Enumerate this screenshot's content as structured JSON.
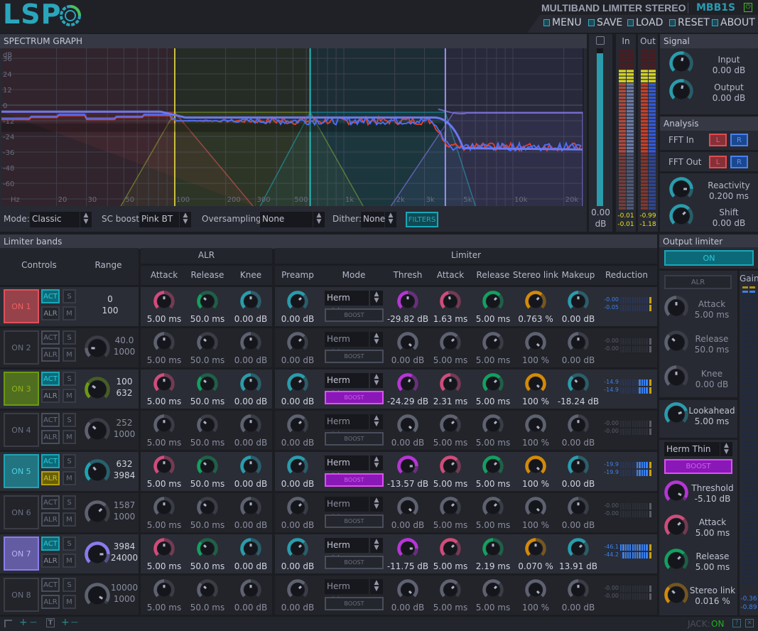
{
  "header": {
    "logo": "LSP",
    "plugin_title": "MULTIBAND LIMITER STEREO",
    "plugin_id": "MBB1S",
    "power_icon": "power-icon",
    "menu": [
      {
        "label": "MENU",
        "icon": "menu-icon"
      },
      {
        "label": "SAVE",
        "icon": "save-icon"
      },
      {
        "label": "LOAD",
        "icon": "load-icon"
      },
      {
        "label": "RESET",
        "icon": "reset-icon"
      },
      {
        "label": "ABOUT",
        "icon": "about-icon"
      }
    ]
  },
  "spectrum": {
    "title": "SPECTRUM GRAPH",
    "y_labels": [
      {
        "t": "dB",
        "db": 40
      },
      {
        "t": "36",
        "db": 36
      },
      {
        "t": "24",
        "db": 24
      },
      {
        "t": "12",
        "db": 12
      },
      {
        "t": "0",
        "db": 0
      },
      {
        "t": "-12",
        "db": -12
      },
      {
        "t": "-24",
        "db": -24
      },
      {
        "t": "-36",
        "db": -36
      },
      {
        "t": "-48",
        "db": -48
      },
      {
        "t": "-60",
        "db": -60
      }
    ],
    "x_labels": [
      {
        "t": "Hz",
        "f": 10.5
      },
      {
        "t": "20",
        "f": 20
      },
      {
        "t": "30",
        "f": 30
      },
      {
        "t": "50",
        "f": 50
      },
      {
        "t": "100",
        "f": 100
      },
      {
        "t": "200",
        "f": 200
      },
      {
        "t": "300",
        "f": 300
      },
      {
        "t": "500",
        "f": 500
      },
      {
        "t": "1k",
        "f": 1000
      },
      {
        "t": "2k",
        "f": 2000
      },
      {
        "t": "3k",
        "f": 3000
      },
      {
        "t": "5k",
        "f": 5000
      },
      {
        "t": "10k",
        "f": 10000
      },
      {
        "t": "20k",
        "f": 20000
      }
    ],
    "colors": {
      "input_left": "#e8402a",
      "input_right": "#4a70ff",
      "curve": "#6a78f0"
    },
    "controls": {
      "mode_label": "Mode:",
      "mode": "Classic",
      "sc_label": "SC boost:",
      "sc": "Pink BT",
      "os_label": "Oversampling:",
      "os": "None",
      "dither_label": "Dither:",
      "dither": "None",
      "filters": "FILTERS"
    }
  },
  "meters": {
    "zoom_value": "0.00",
    "zoom_unit": "dB",
    "zoom_level": 0.97,
    "in_label": "In",
    "out_label": "Out",
    "in_values": [
      "-0.01",
      "-0.01"
    ],
    "out_values": [
      "-0.99",
      "-1.18"
    ]
  },
  "signal": {
    "title": "Signal",
    "input_label": "Input",
    "input": "0.00 dB",
    "input_pos": 0.55,
    "output_label": "Output",
    "output": "0.00 dB",
    "output_pos": 0.55
  },
  "analysis": {
    "title": "Analysis",
    "fft_in": "FFT In",
    "fft_out": "FFT Out",
    "l": "L",
    "r": "R",
    "reactivity_label": "Reactivity",
    "reactivity": "0.200 ms",
    "reactivity_pos": 0.83,
    "shift_label": "Shift",
    "shift": "0.00 dB",
    "shift_pos": 0.67
  },
  "bands_panel": {
    "title": "Limiter bands",
    "controls": "Controls",
    "range": "Range",
    "alr": "ALR",
    "limiter": "Limiter",
    "alr_cols": [
      "Attack",
      "Release",
      "Knee"
    ],
    "lim_cols": [
      "Preamp",
      "Mode",
      "Thresh",
      "Attack",
      "Release",
      "Stereo link",
      "Makeup",
      "Reduction"
    ],
    "labels": {
      "act": "ACT",
      "alr": "ALR",
      "solo": "S",
      "mute": "M",
      "boost": "BOOST"
    },
    "knob_colors": {
      "attack": "#d04c7c",
      "release": "#12a060",
      "cyan": "#2a9cac",
      "thresh": "#b834d8",
      "link": "#d48a08",
      "inactive": "#565a66"
    }
  },
  "bands": [
    {
      "label": "ON 1",
      "color": "#e0505a",
      "active": true,
      "act": true,
      "alr": false,
      "range": [
        "0",
        "100"
      ],
      "range_pos": null,
      "alr_knobs": [
        {
          "v": "5.00 ms",
          "p": 0.5
        },
        {
          "v": "50.0 ms",
          "p": 0.33
        },
        {
          "v": "0.00 dB",
          "p": 0.5
        }
      ],
      "preamp": {
        "v": "0.00 dB",
        "p": 0.67
      },
      "mode": "Herm Thin",
      "boost": false,
      "lim": [
        {
          "v": "-29.82 dB",
          "p": 0.5
        },
        {
          "v": "1.63 ms",
          "p": 0.45
        },
        {
          "v": "5.00 ms",
          "p": 0.67
        },
        {
          "v": "0.763 %",
          "p": 0.65
        },
        {
          "v": "0.00 dB",
          "p": 0.5
        }
      ],
      "reduction": [
        "-0.00",
        "-0.05"
      ]
    },
    {
      "label": "ON 2",
      "color": "#4a4e5a",
      "active": false,
      "act": false,
      "alr": false,
      "range": [
        "40.0",
        "1000"
      ],
      "range_pos": 0.17,
      "alr_knobs": [
        {
          "v": "5.00 ms",
          "p": 0.5
        },
        {
          "v": "50.0 ms",
          "p": 0.33
        },
        {
          "v": "0.00 dB",
          "p": 0.5
        }
      ],
      "preamp": {
        "v": "0.00 dB",
        "p": 0.67
      },
      "mode": "Herm Thin",
      "boost": false,
      "lim": [
        {
          "v": "0.00 dB",
          "p": 1.0
        },
        {
          "v": "5.00 ms",
          "p": 0.67
        },
        {
          "v": "5.00 ms",
          "p": 0.67
        },
        {
          "v": "100 %",
          "p": 1.0
        },
        {
          "v": "0.00 dB",
          "p": 0.5
        }
      ],
      "reduction": [
        "-0.00",
        "-0.00"
      ]
    },
    {
      "label": "ON 3",
      "color": "#6a9a12",
      "active": true,
      "act": true,
      "alr": false,
      "range": [
        "100",
        "632"
      ],
      "range_pos": 0.3,
      "alr_knobs": [
        {
          "v": "5.00 ms",
          "p": 0.5
        },
        {
          "v": "50.0 ms",
          "p": 0.33
        },
        {
          "v": "0.00 dB",
          "p": 0.5
        }
      ],
      "preamp": {
        "v": "0.00 dB",
        "p": 0.67
      },
      "mode": "Herm Thin",
      "boost": true,
      "lim": [
        {
          "v": "-24.29 dB",
          "p": 0.6
        },
        {
          "v": "2.31 ms",
          "p": 0.5
        },
        {
          "v": "5.00 ms",
          "p": 0.67
        },
        {
          "v": "100 %",
          "p": 1.0
        },
        {
          "v": "-18.24 dB",
          "p": 0.35
        }
      ],
      "reduction": [
        "-14.9",
        "-14.9"
      ]
    },
    {
      "label": "ON 4",
      "color": "#4a4e5a",
      "active": false,
      "act": false,
      "alr": false,
      "range": [
        "252",
        "1000"
      ],
      "range_pos": 0.33,
      "alr_knobs": [
        {
          "v": "5.00 ms",
          "p": 0.5
        },
        {
          "v": "50.0 ms",
          "p": 0.33
        },
        {
          "v": "0.00 dB",
          "p": 0.5
        }
      ],
      "preamp": {
        "v": "0.00 dB",
        "p": 0.67
      },
      "mode": "Herm Thin",
      "boost": false,
      "lim": [
        {
          "v": "0.00 dB",
          "p": 1.0
        },
        {
          "v": "5.00 ms",
          "p": 0.67
        },
        {
          "v": "5.00 ms",
          "p": 0.67
        },
        {
          "v": "100 %",
          "p": 1.0
        },
        {
          "v": "0.00 dB",
          "p": 0.5
        }
      ],
      "reduction": [
        "-0.00",
        "-0.00"
      ]
    },
    {
      "label": "ON 5",
      "color": "#1ea4b4",
      "active": true,
      "act": true,
      "alr": true,
      "range": [
        "632",
        "3984"
      ],
      "range_pos": 0.35,
      "alr_knobs": [
        {
          "v": "5.00 ms",
          "p": 0.5
        },
        {
          "v": "50.0 ms",
          "p": 0.33
        },
        {
          "v": "0.00 dB",
          "p": 0.5
        }
      ],
      "preamp": {
        "v": "0.00 dB",
        "p": 0.67
      },
      "mode": "Herm Thin",
      "boost": true,
      "lim": [
        {
          "v": "-13.57 dB",
          "p": 0.83
        },
        {
          "v": "5.00 ms",
          "p": 0.67
        },
        {
          "v": "5.00 ms",
          "p": 0.67
        },
        {
          "v": "100 %",
          "p": 1.0
        },
        {
          "v": "0.00 dB",
          "p": 0.5
        }
      ],
      "reduction": [
        "-19.9",
        "-19.9"
      ]
    },
    {
      "label": "ON 6",
      "color": "#4a4e5a",
      "active": false,
      "act": false,
      "alr": false,
      "range": [
        "1587",
        "1000"
      ],
      "range_pos": 0.67,
      "alr_knobs": [
        {
          "v": "5.00 ms",
          "p": 0.5
        },
        {
          "v": "50.0 ms",
          "p": 0.33
        },
        {
          "v": "0.00 dB",
          "p": 0.5
        }
      ],
      "preamp": {
        "v": "0.00 dB",
        "p": 0.67
      },
      "mode": "Herm Thin",
      "boost": false,
      "lim": [
        {
          "v": "0.00 dB",
          "p": 1.0
        },
        {
          "v": "5.00 ms",
          "p": 0.67
        },
        {
          "v": "5.00 ms",
          "p": 0.67
        },
        {
          "v": "100 %",
          "p": 1.0
        },
        {
          "v": "0.00 dB",
          "p": 0.5
        }
      ],
      "reduction": [
        "-0.00",
        "-0.00"
      ]
    },
    {
      "label": "ON 7",
      "color": "#8a7cec",
      "active": true,
      "act": true,
      "alr": false,
      "range": [
        "3984",
        "24000"
      ],
      "range_pos": 0.83,
      "alr_knobs": [
        {
          "v": "5.00 ms",
          "p": 0.5
        },
        {
          "v": "50.0 ms",
          "p": 0.33
        },
        {
          "v": "0.00 dB",
          "p": 0.5
        }
      ],
      "preamp": {
        "v": "0.00 dB",
        "p": 0.67
      },
      "mode": "Herm Thin",
      "boost": false,
      "lim": [
        {
          "v": "-11.75 dB",
          "p": 0.83
        },
        {
          "v": "5.00 ms",
          "p": 0.67
        },
        {
          "v": "2.19 ms",
          "p": 0.5
        },
        {
          "v": "0.070 %",
          "p": 0.5
        },
        {
          "v": "13.91 dB",
          "p": 0.67
        }
      ],
      "reduction": [
        "-46.1",
        "-44.2"
      ]
    },
    {
      "label": "ON 8",
      "color": "#4a4e5a",
      "active": false,
      "act": false,
      "alr": false,
      "range": [
        "10000",
        "1000"
      ],
      "range_pos": 0.95,
      "alr_knobs": [
        {
          "v": "5.00 ms",
          "p": 0.5
        },
        {
          "v": "50.0 ms",
          "p": 0.33
        },
        {
          "v": "0.00 dB",
          "p": 0.5
        }
      ],
      "preamp": {
        "v": "0.00 dB",
        "p": 0.67
      },
      "mode": "Herm Thin",
      "boost": false,
      "lim": [
        {
          "v": "0.00 dB",
          "p": 1.0
        },
        {
          "v": "5.00 ms",
          "p": 0.67
        },
        {
          "v": "5.00 ms",
          "p": 0.67
        },
        {
          "v": "100 %",
          "p": 1.0
        },
        {
          "v": "0.00 dB",
          "p": 0.5
        }
      ],
      "reduction": [
        "-0.00",
        "-0.00"
      ]
    }
  ],
  "output_limiter": {
    "title": "Output limiter",
    "on": "ON",
    "alr": "ALR",
    "gain_label": "Gain",
    "gain_values": [
      "-0.36",
      "-0.89"
    ],
    "knobs": [
      {
        "label": "Attack",
        "v": "5.00 ms",
        "p": 0.5,
        "color": "inactive"
      },
      {
        "label": "Release",
        "v": "50.0 ms",
        "p": 0.33,
        "color": "inactive"
      },
      {
        "label": "Knee",
        "v": "0.00 dB",
        "p": 0.5,
        "color": "inactive"
      },
      {
        "label": "Lookahead",
        "v": "5.00 ms",
        "p": 0.76,
        "color": "cyan"
      }
    ],
    "mode": "Herm Thin",
    "boost": "BOOST",
    "lim_knobs": [
      {
        "label": "Threshold",
        "v": "-5.10 dB",
        "p": 0.94,
        "color": "thresh"
      },
      {
        "label": "Attack",
        "v": "5.00 ms",
        "p": 0.67,
        "color": "attack"
      },
      {
        "label": "Release",
        "v": "5.00 ms",
        "p": 0.67,
        "color": "release"
      },
      {
        "label": "Stereo link",
        "v": "0.016 %",
        "p": 0.33,
        "color": "link"
      }
    ]
  },
  "footer": {
    "jack_label": "JACK:",
    "jack_status": "ON"
  }
}
